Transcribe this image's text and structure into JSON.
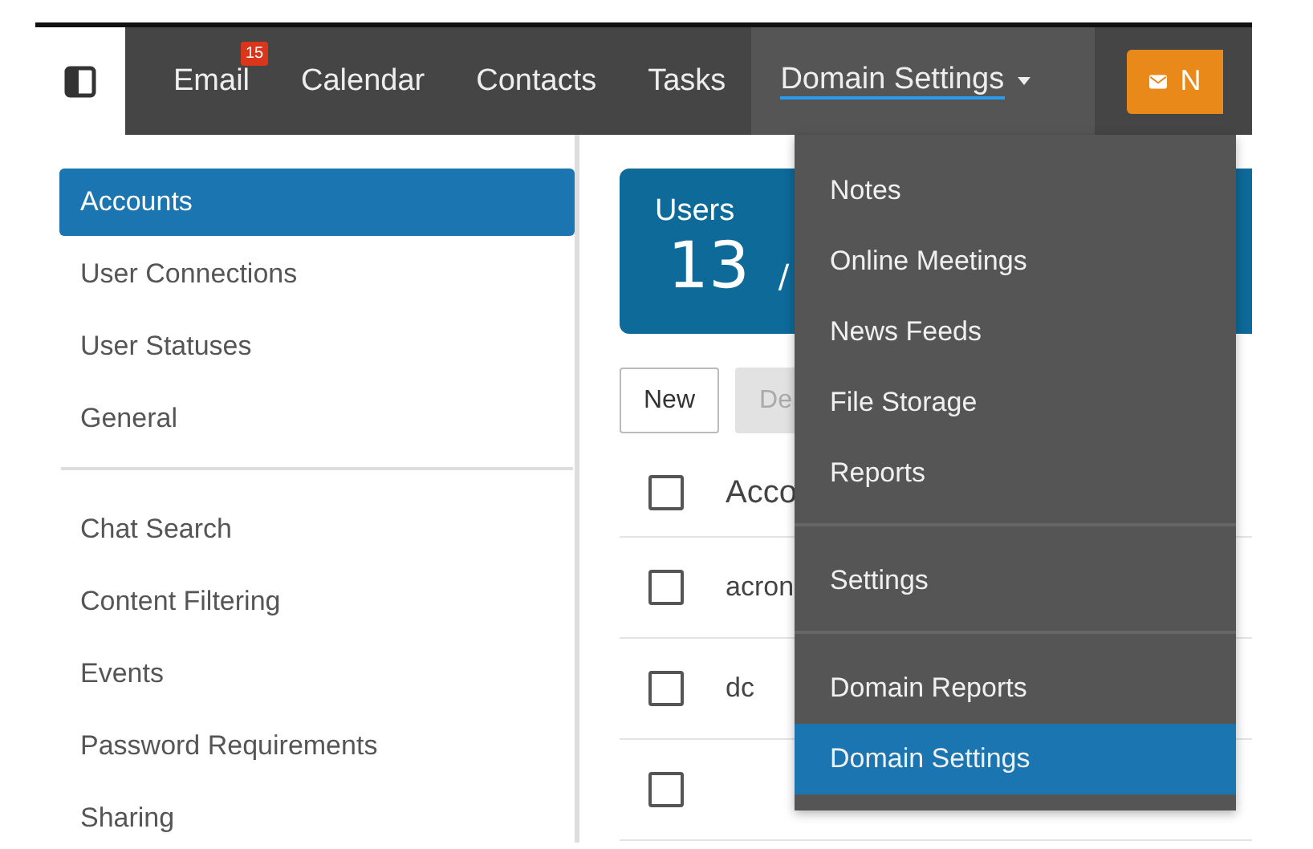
{
  "nav": {
    "tabs": [
      {
        "label": "Email",
        "badge": "15",
        "selected": false,
        "dropdown": false
      },
      {
        "label": "Calendar",
        "selected": false,
        "dropdown": false
      },
      {
        "label": "Contacts",
        "selected": false,
        "dropdown": false
      },
      {
        "label": "Tasks",
        "selected": false,
        "dropdown": false
      },
      {
        "label": "Domain Settings",
        "selected": true,
        "dropdown": true
      }
    ],
    "compose_button": "N"
  },
  "sidebar": {
    "groups": [
      [
        {
          "label": "Accounts",
          "selected": true
        },
        {
          "label": "User Connections",
          "selected": false
        },
        {
          "label": "User Statuses",
          "selected": false
        },
        {
          "label": "General",
          "selected": false
        }
      ],
      [
        {
          "label": "Chat Search",
          "selected": false
        },
        {
          "label": "Content Filtering",
          "selected": false
        },
        {
          "label": "Events",
          "selected": false
        },
        {
          "label": "Password Requirements",
          "selected": false
        },
        {
          "label": "Sharing",
          "selected": false
        }
      ]
    ]
  },
  "users_card": {
    "label": "Users",
    "count": "13",
    "total": "/"
  },
  "toolbar": [
    {
      "label": "New",
      "disabled": false
    },
    {
      "label": "De",
      "disabled": true
    }
  ],
  "table": {
    "header": "Acco",
    "header_checked": false,
    "rows": [
      {
        "cell": "acron",
        "checked": false
      },
      {
        "cell": "dc",
        "checked": false
      },
      {
        "checked": false
      }
    ]
  },
  "menu": {
    "groups": [
      [
        {
          "label": "Notes",
          "selected": false
        },
        {
          "label": "Online Meetings",
          "selected": false
        },
        {
          "label": "News Feeds",
          "selected": false
        },
        {
          "label": "File Storage",
          "selected": false
        },
        {
          "label": "Reports",
          "selected": false
        }
      ],
      [
        {
          "label": "Settings",
          "selected": false
        }
      ],
      [
        {
          "label": "Domain Reports",
          "selected": false
        },
        {
          "label": "Domain Settings",
          "selected": true
        }
      ]
    ]
  }
}
